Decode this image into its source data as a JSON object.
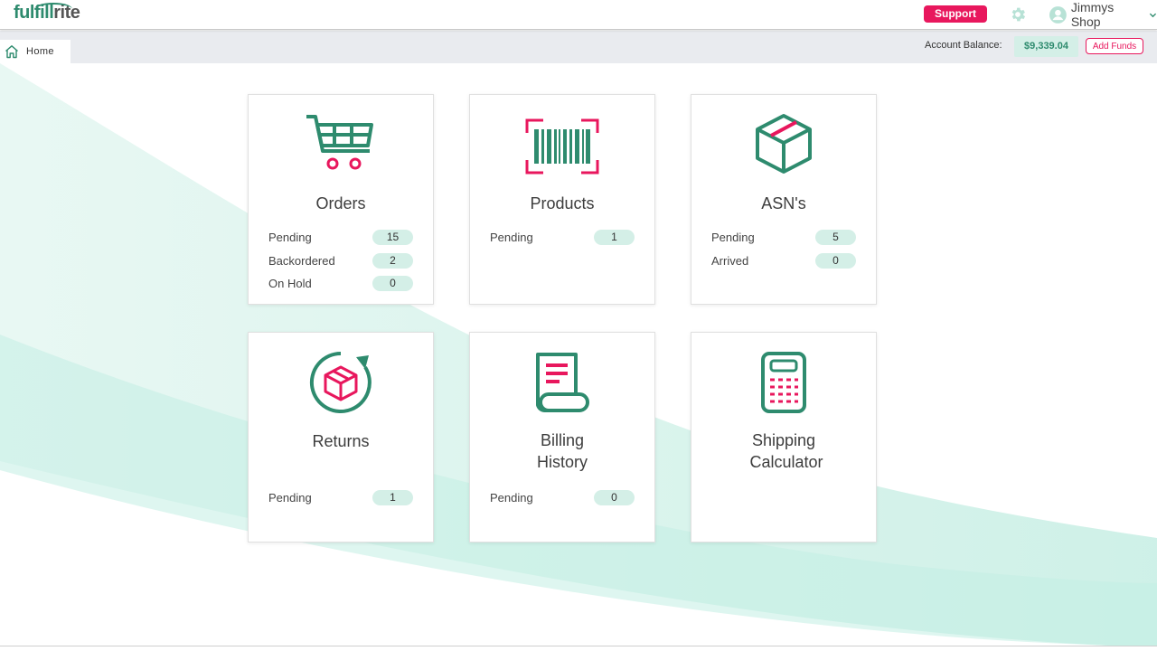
{
  "header": {
    "logo_green": "fulfill",
    "logo_dark": "rite",
    "support_label": "Support",
    "settings_icon": "gear-icon",
    "user_icon": "user-circle-icon",
    "user_name": "Jimmys Shop"
  },
  "subbar": {
    "home_tab": "Home",
    "balance_label": "Account Balance:",
    "balance_value": "$9,339.04",
    "add_funds_label": "Add Funds"
  },
  "colors": {
    "accent_green": "#2e8b6e",
    "accent_pink": "#e8175d",
    "badge_bg": "#d4efe7"
  },
  "cards": [
    {
      "title": "Orders",
      "icon": "shopping-cart-icon",
      "rows": [
        {
          "label": "Pending",
          "value": "15"
        },
        {
          "label": "Backordered",
          "value": "2"
        },
        {
          "label": "On Hold",
          "value": "0"
        }
      ]
    },
    {
      "title": "Products",
      "icon": "barcode-icon",
      "rows": [
        {
          "label": "Pending",
          "value": "1"
        }
      ]
    },
    {
      "title": "ASN's",
      "icon": "box-icon",
      "rows": [
        {
          "label": "Pending",
          "value": "5"
        },
        {
          "label": "Arrived",
          "value": "0"
        }
      ]
    },
    {
      "title": "Returns",
      "icon": "return-box-icon",
      "rows": [
        {
          "label": "Pending",
          "value": "1"
        }
      ]
    },
    {
      "title_line1": "Billing",
      "title_line2": "History",
      "icon": "invoice-icon",
      "rows": [
        {
          "label": "Pending",
          "value": "0"
        }
      ]
    },
    {
      "title_line1": "Shipping",
      "title_line2": "Calculator",
      "icon": "calculator-icon",
      "rows": []
    }
  ]
}
